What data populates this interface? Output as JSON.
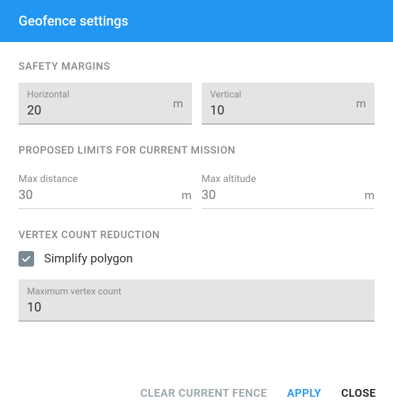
{
  "title": "Geofence settings",
  "sections": {
    "safety": {
      "heading": "SAFETY MARGINS",
      "horizontal": {
        "label": "Horizontal",
        "value": "20",
        "unit": "m"
      },
      "vertical": {
        "label": "Vertical",
        "value": "10",
        "unit": "m"
      }
    },
    "proposed": {
      "heading": "PROPOSED LIMITS FOR CURRENT MISSION",
      "maxDistance": {
        "label": "Max distance",
        "value": "30",
        "unit": "m"
      },
      "maxAltitude": {
        "label": "Max altitude",
        "value": "30",
        "unit": "m"
      }
    },
    "vertex": {
      "heading": "VERTEX COUNT REDUCTION",
      "simplify": {
        "label": "Simplify polygon",
        "checked": true
      },
      "maxVertex": {
        "label": "Maximum vertex count",
        "value": "10"
      }
    }
  },
  "buttons": {
    "clear": "CLEAR CURRENT FENCE",
    "apply": "APPLY",
    "close": "CLOSE"
  }
}
